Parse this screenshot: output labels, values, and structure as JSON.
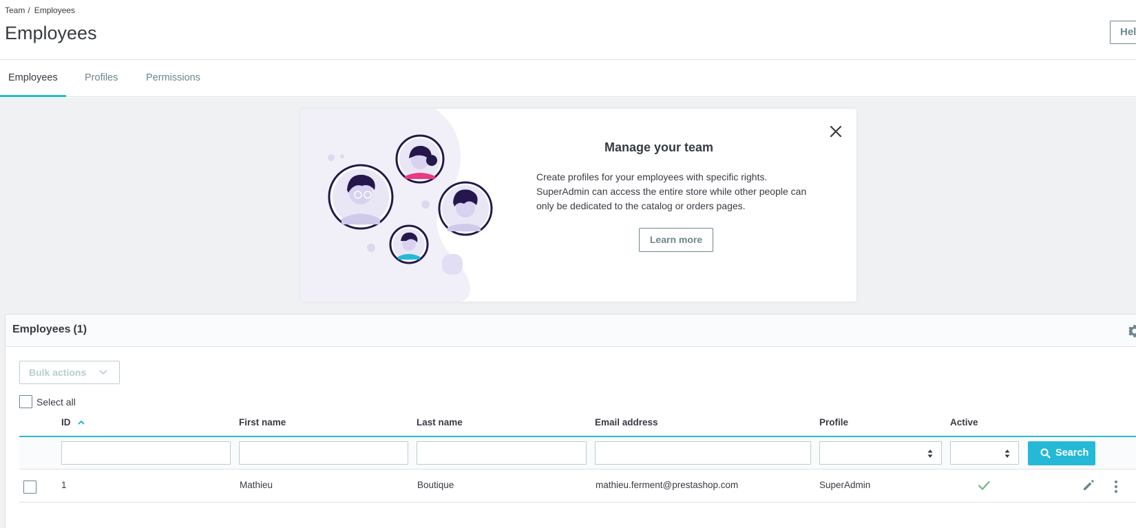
{
  "breadcrumb": {
    "parent": "Team",
    "current": "Employees"
  },
  "page": {
    "title": "Employees",
    "help_label": "Help"
  },
  "tabs": [
    {
      "label": "Employees",
      "active": true
    },
    {
      "label": "Profiles",
      "active": false
    },
    {
      "label": "Permissions",
      "active": false
    }
  ],
  "banner": {
    "title": "Manage your team",
    "text": "Create profiles for your employees with specific rights. SuperAdmin can access the entire store while other people can only be dedicated to the catalog or orders pages.",
    "learn_more": "Learn more"
  },
  "employees_card": {
    "title": "Employees",
    "count": "(1)",
    "bulk_actions": "Bulk actions",
    "select_all": "Select all",
    "columns": {
      "id": "ID",
      "first_name": "First name",
      "last_name": "Last name",
      "email": "Email address",
      "profile": "Profile",
      "active": "Active"
    },
    "search_label": "Search",
    "rows": [
      {
        "id": "1",
        "first_name": "Mathieu",
        "last_name": "Boutique",
        "email": "mathieu.ferment@prestashop.com",
        "profile": "SuperAdmin",
        "active": true
      }
    ]
  },
  "colors": {
    "accent": "#25b9d7",
    "text": "#363a41",
    "muted": "#6c868e",
    "success": "#70b580",
    "illustration": "#25174b"
  },
  "icons": {
    "close": "close-icon",
    "gear": "gear-icon",
    "sort": "sort-asc-icon",
    "search": "search-icon",
    "check": "check-icon",
    "edit": "edit-icon",
    "more": "more-vert-icon"
  }
}
